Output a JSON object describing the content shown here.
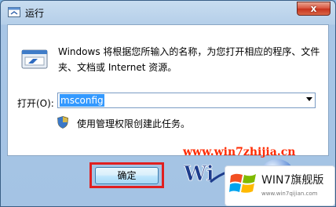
{
  "window": {
    "title": "运行",
    "close_glyph": "x"
  },
  "dialog": {
    "description": "Windows 将根据您所输入的名称，为您打开相应的程序、文件夹、文档或 Internet 资源。",
    "open_label": "打开(O):",
    "command_value": "msconfig",
    "admin_note": "使用管理权限创建此任务。",
    "ok_label": "确定"
  },
  "watermark": {
    "site": "www.win7zhijia.cn",
    "badge_title": "WIN7旗舰版",
    "badge_url": "www.win7qijian.com"
  },
  "icons": [
    "run-app-icon",
    "run-dialog-icon",
    "shield-icon",
    "dropdown-arrow-icon",
    "windows-flag-icon"
  ],
  "colors": {
    "selection": "#3399ff",
    "highlight_box": "#e02020",
    "watermark_text": "#ff2a00"
  }
}
